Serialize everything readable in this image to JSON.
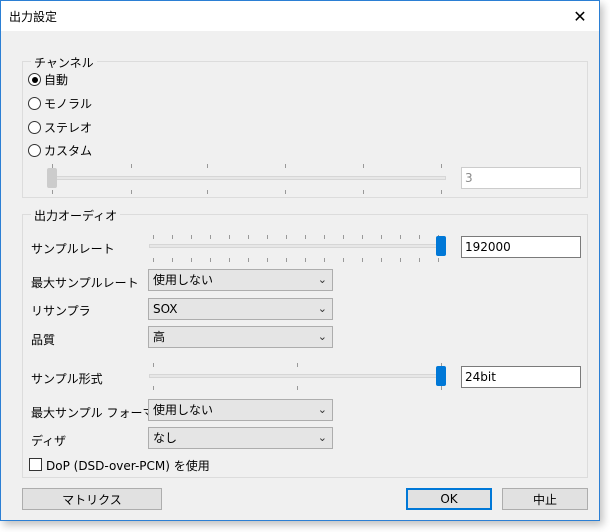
{
  "window": {
    "title": "出力設定"
  },
  "channel": {
    "group_label": "チャンネル",
    "options": [
      "自動",
      "モノラル",
      "ステレオ",
      "カスタム"
    ],
    "selected_index": 0,
    "count_value": "3"
  },
  "output_audio": {
    "group_label": "出力オーディオ",
    "sample_rate": {
      "label": "サンプルレート",
      "value": "192000",
      "slider_fraction": 1.0
    },
    "max_sample_rate": {
      "label": "最大サンプルレート",
      "value": "使用しない"
    },
    "resampler": {
      "label": "リサンプラ",
      "value": "SOX"
    },
    "quality": {
      "label": "品質",
      "value": "高"
    },
    "sample_format": {
      "label": "サンプル形式",
      "value": "24bit",
      "slider_fraction": 1.0
    },
    "max_sample_format": {
      "label": "最大サンプル フォーマット",
      "value": "使用しない"
    },
    "dither": {
      "label": "ディザ",
      "value": "なし"
    },
    "dop": {
      "label": "DoP (DSD-over-PCM) を使用",
      "checked": false
    }
  },
  "buttons": {
    "matrix": "マトリクス",
    "ok": "OK",
    "cancel": "中止"
  },
  "colors": {
    "accent": "#0078d7",
    "window_border": "#2b7fd4"
  }
}
